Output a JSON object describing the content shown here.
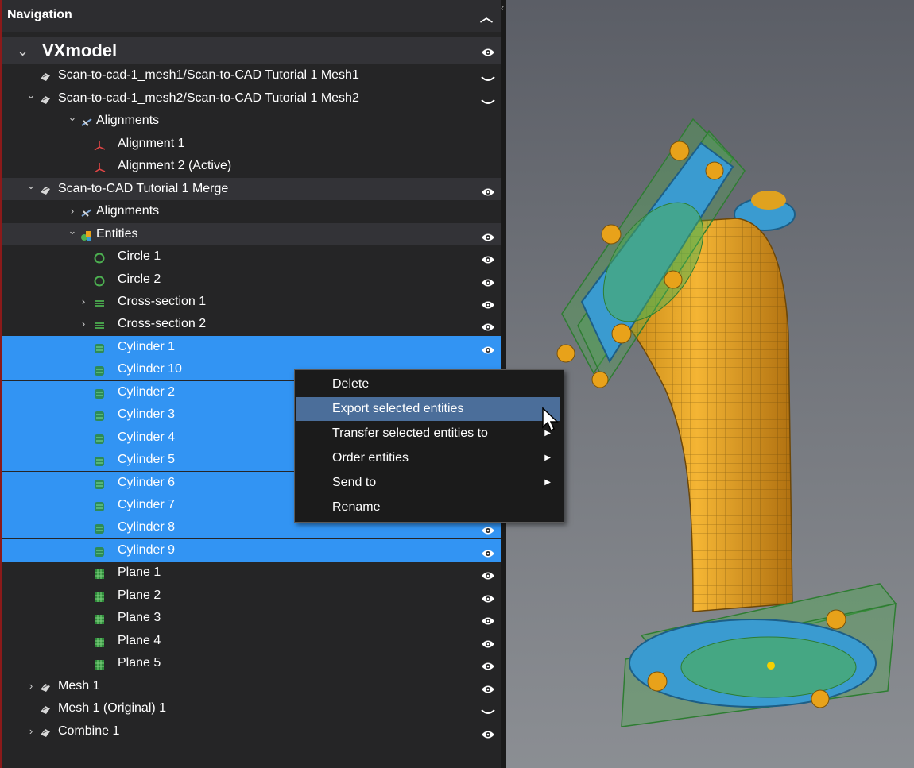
{
  "nav": {
    "title": "Navigation",
    "collapse_icon": "chevron-up-icon",
    "rows": [
      {
        "label": "VXmodel",
        "level": 0,
        "chev": "down",
        "icon": "",
        "eye": "open",
        "style": "bar"
      },
      {
        "label": "Scan-to-cad-1_mesh1/Scan-to-CAD Tutorial 1 Mesh1",
        "level": 1,
        "chev": "",
        "icon": "mesh",
        "eye": "closed",
        "style": ""
      },
      {
        "label": "Scan-to-cad-1_mesh2/Scan-to-CAD Tutorial 1 Mesh2",
        "level": 1,
        "chev": "down",
        "icon": "mesh",
        "eye": "closed",
        "style": ""
      },
      {
        "label": "Alignments",
        "level": 2,
        "chev": "down",
        "icon": "align",
        "eye": "",
        "style": ""
      },
      {
        "label": "Alignment 1",
        "level": 3,
        "chev": "",
        "icon": "axis",
        "eye": "",
        "style": ""
      },
      {
        "label": "Alignment 2 (Active)",
        "level": 3,
        "chev": "",
        "icon": "axis",
        "eye": "",
        "style": ""
      },
      {
        "label": "Scan-to-CAD Tutorial 1 Merge",
        "level": 1,
        "chev": "down",
        "icon": "mesh",
        "eye": "open",
        "style": "bar"
      },
      {
        "label": "Alignments",
        "level": 2,
        "chev": "right",
        "icon": "align",
        "eye": "",
        "style": ""
      },
      {
        "label": "Entities",
        "level": 2,
        "chev": "down",
        "icon": "entities",
        "eye": "open",
        "style": "bar"
      },
      {
        "label": "Circle 1",
        "level": 3,
        "chev": "",
        "icon": "circle",
        "eye": "open",
        "style": ""
      },
      {
        "label": "Circle 2",
        "level": 3,
        "chev": "",
        "icon": "circle",
        "eye": "open",
        "style": ""
      },
      {
        "label": "Cross-section 1",
        "level": 3,
        "chev": "right",
        "icon": "cross",
        "eye": "open",
        "style": ""
      },
      {
        "label": "Cross-section 2",
        "level": 3,
        "chev": "right",
        "icon": "cross",
        "eye": "open",
        "style": ""
      },
      {
        "label": "Cylinder 1",
        "level": 3,
        "chev": "",
        "icon": "cylinder",
        "eye": "open",
        "style": "sel"
      },
      {
        "label": "Cylinder 10",
        "level": 3,
        "chev": "",
        "icon": "cylinder",
        "eye": "open",
        "style": "sel"
      },
      {
        "label": "Cylinder 2",
        "level": 3,
        "chev": "",
        "icon": "cylinder",
        "eye": "",
        "style": "sel"
      },
      {
        "label": "Cylinder 3",
        "level": 3,
        "chev": "",
        "icon": "cylinder",
        "eye": "",
        "style": "sel"
      },
      {
        "label": "Cylinder 4",
        "level": 3,
        "chev": "",
        "icon": "cylinder",
        "eye": "",
        "style": "sel"
      },
      {
        "label": "Cylinder 5",
        "level": 3,
        "chev": "",
        "icon": "cylinder",
        "eye": "",
        "style": "sel"
      },
      {
        "label": "Cylinder 6",
        "level": 3,
        "chev": "",
        "icon": "cylinder",
        "eye": "",
        "style": "sel"
      },
      {
        "label": "Cylinder 7",
        "level": 3,
        "chev": "",
        "icon": "cylinder",
        "eye": "",
        "style": "sel"
      },
      {
        "label": "Cylinder 8",
        "level": 3,
        "chev": "",
        "icon": "cylinder",
        "eye": "open",
        "style": "sel"
      },
      {
        "label": "Cylinder 9",
        "level": 3,
        "chev": "",
        "icon": "cylinder",
        "eye": "open",
        "style": "sel"
      },
      {
        "label": "Plane 1",
        "level": 3,
        "chev": "",
        "icon": "plane",
        "eye": "open",
        "style": ""
      },
      {
        "label": "Plane 2",
        "level": 3,
        "chev": "",
        "icon": "plane",
        "eye": "open",
        "style": ""
      },
      {
        "label": "Plane 3",
        "level": 3,
        "chev": "",
        "icon": "plane",
        "eye": "open",
        "style": ""
      },
      {
        "label": "Plane 4",
        "level": 3,
        "chev": "",
        "icon": "plane",
        "eye": "open",
        "style": ""
      },
      {
        "label": "Plane 5",
        "level": 3,
        "chev": "",
        "icon": "plane",
        "eye": "open",
        "style": ""
      },
      {
        "label": "Mesh 1",
        "level": 1,
        "chev": "right",
        "icon": "mesh",
        "eye": "open",
        "style": ""
      },
      {
        "label": "Mesh 1 (Original) 1",
        "level": 1,
        "chev": "",
        "icon": "mesh",
        "eye": "closed",
        "style": ""
      },
      {
        "label": "Combine 1",
        "level": 1,
        "chev": "right",
        "icon": "mesh",
        "eye": "open",
        "style": ""
      }
    ]
  },
  "context_menu": {
    "items": [
      {
        "label": "Delete",
        "submenu": false,
        "highlighted": false
      },
      {
        "label": "Export selected entities",
        "submenu": false,
        "highlighted": true
      },
      {
        "label": "Transfer selected entities to",
        "submenu": true,
        "highlighted": false
      },
      {
        "label": "Order entities",
        "submenu": true,
        "highlighted": false
      },
      {
        "label": "Send to",
        "submenu": true,
        "highlighted": false
      },
      {
        "label": "Rename",
        "submenu": false,
        "highlighted": false
      }
    ]
  },
  "splitter": {
    "collapse_glyph": "‹"
  },
  "viewport": {
    "content": "3d-model-elbow-pipe"
  },
  "colors": {
    "selection": "#3294f3",
    "menu_highlight": "#4b6e9a",
    "pipe": "#e8a21a",
    "flange": "#3a9bd0",
    "plane": "#4caf50"
  }
}
